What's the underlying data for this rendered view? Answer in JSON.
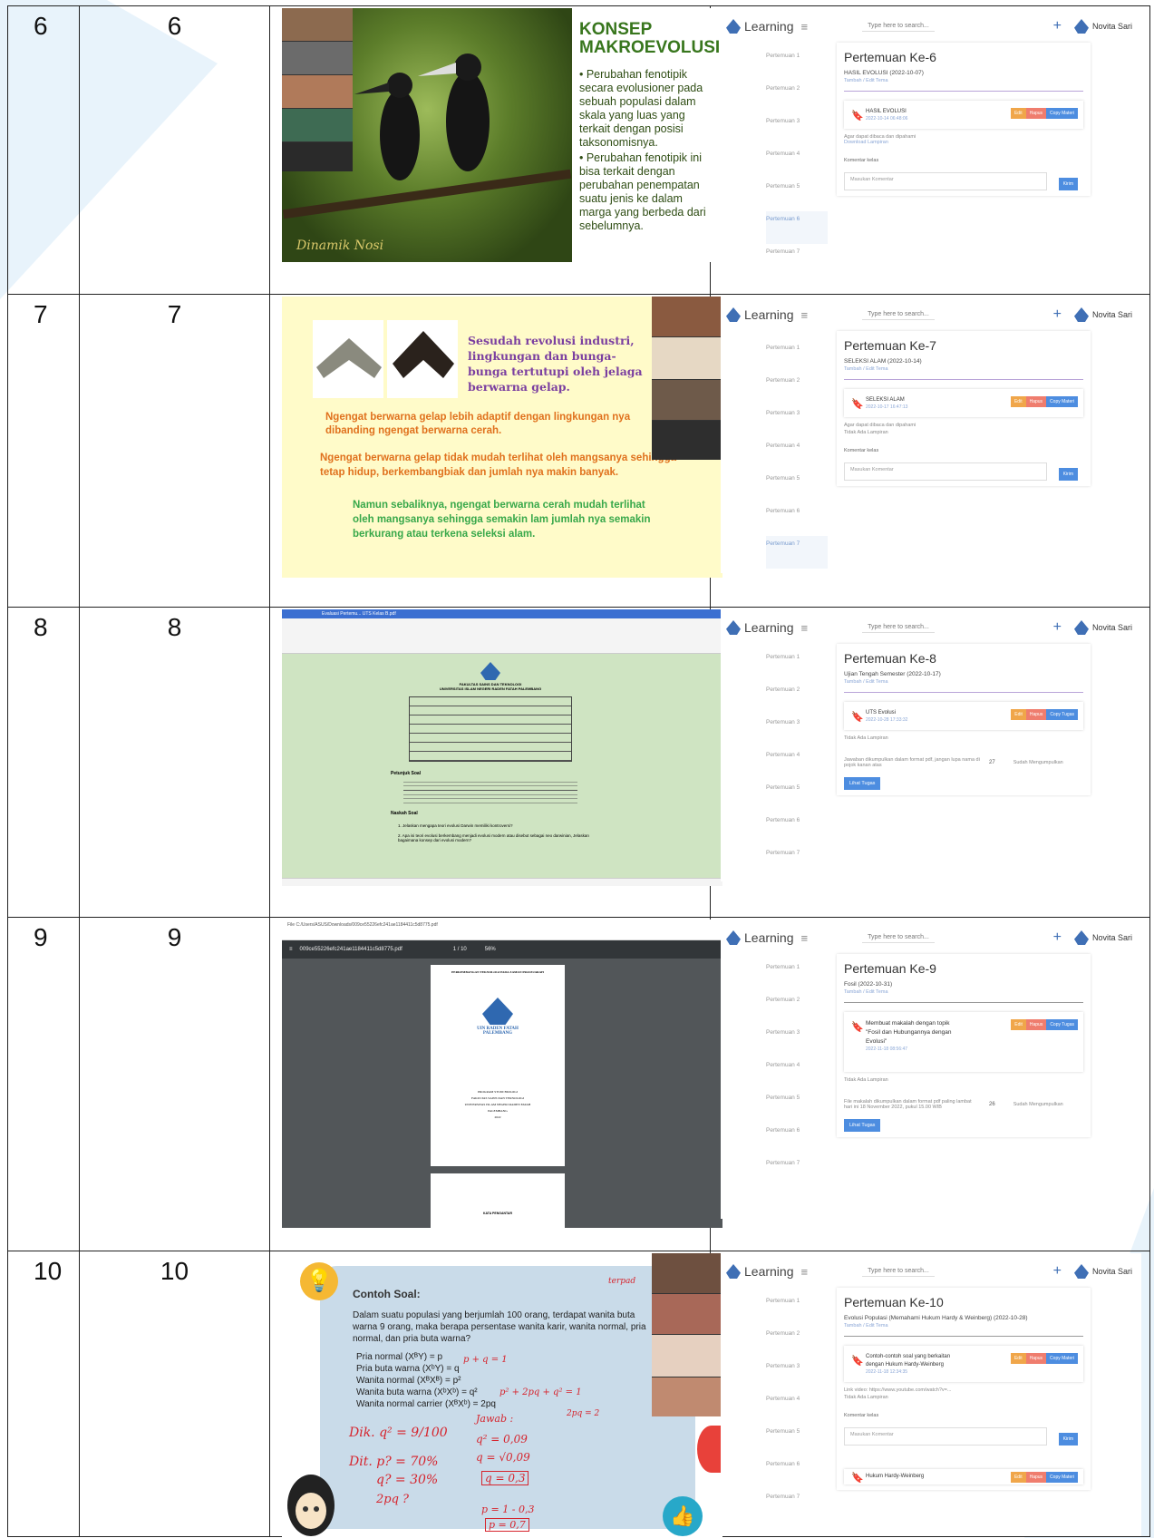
{
  "rows": [
    {
      "no_a": "6",
      "no_b": "6",
      "slide": {
        "title": "KONSEP MAKROEVOLUSI",
        "bullets": [
          "• Perubahan fenotipik secara evolusioner pada sebuah populasi dalam skala yang luas yang terkait dengan posisi taksonomisnya.",
          "• Perubahan fenotipik ini bisa terkait dengan perubahan penempatan suatu jenis ke dalam marga yang berbeda dari sebelumnya."
        ],
        "signature": "Dinamik Nosi"
      },
      "lms": {
        "title": "Pertemuan Ke-6",
        "subtitle": "HASIL EVOLUSI (2022-10-07)",
        "edit_link": "Tambah / Edit Tema",
        "item_title": "HASIL EVOLUSI",
        "item_date": "2022-10-14 06:48:06",
        "note1": "Agar dapat dibaca dan dipahami",
        "note2": "Download Lampiran",
        "komentar_label": "Komentar kelas",
        "komentar_placeholder": "Masukan Komentar",
        "active_index": 5
      }
    },
    {
      "no_a": "7",
      "no_b": "7",
      "slide": {
        "line1": "Sesudah revolusi industri, lingkungan dan bunga- bunga tertutupi oleh jelaga berwarna gelap.",
        "line2": "Ngengat berwarna gelap lebih adaptif dengan lingkungan nya dibanding ngengat berwarna cerah.",
        "line3": "Ngengat berwarna gelap tidak mudah terlihat oleh mangsanya sehingga tetap hidup, berkembangbiak dan jumlah nya makin banyak.",
        "line4": "Namun sebaliknya, ngengat berwarna cerah mudah terlihat oleh mangsanya sehingga semakin lam jumlah nya semakin berkurang atau terkena seleksi alam."
      },
      "lms": {
        "title": "Pertemuan Ke-7",
        "subtitle": "SELEKSI ALAM (2022-10-14)",
        "edit_link": "Tambah / Edit Tema",
        "item_title": "SELEKSI ALAM",
        "item_date": "2022-10-17 16:47:13",
        "note1": "Agar dapat dibaca dan dipahami",
        "note2": "Tidak Ada Lampiran",
        "komentar_label": "Komentar kelas",
        "komentar_placeholder": "Masukan Komentar",
        "active_index": 6
      }
    },
    {
      "no_a": "8",
      "no_b": "8",
      "slide": {
        "app_tab": "Evaluasi Pertemu... UTS Kelas B.pdf",
        "header1": "FAKULTAS SAINS DAN TEKNOLOGI",
        "header2": "UNIVERSITAS ISLAM NEGERI RADEN FATAH PALEMBANG",
        "section1": "Petunjuk Soal",
        "section2": "Naskah Soal",
        "q1": "1. Jelaskan mengapa teori evolusi Darwin memiliki kontroversi?",
        "q2": "2. Apa isi teori evolusi berkembang menjadi evolusi modern atau disebut sebagai neo darwinian, Jelaskan bagaimana konsep dari evolusi modern?"
      },
      "lms": {
        "title": "Pertemuan Ke-8",
        "subtitle": "Ujian Tengah Semester (2022-10-17)",
        "edit_link": "Tambah / Edit Tema",
        "item_title": "UTS Evolusi",
        "item_date": "2022-10-28 17:33:32",
        "note1": "Tidak Ada Lampiran",
        "note2": "Jawaban dikumpulkan dalam format pdf, jangan lupa nama di pojok kanan atas",
        "count": "27",
        "collected": "Sudah Mengumpulkan",
        "button": "Lihat Tugas",
        "active_index": -1
      }
    },
    {
      "no_a": "9",
      "no_b": "9",
      "slide": {
        "url": "File  C:/Users/ASUS/Downloads/009ce55226efc241ae1184411c5d8775.pdf",
        "filename": "009ce55226efc241ae1184411c5d8775.pdf",
        "page": "1 / 10",
        "zoom": "56%",
        "doc_title": "PERKEMBANGAN TEKNOLOGI PADA ZAMAN PRASEJARAH",
        "uin": "UIN RADEN FATAH PALEMBANG",
        "prodi": "PROGRAM STUDI BIOLOGI",
        "fak": "FAKULTAS SAINS DAN TEKNOLOGI",
        "univ": "UNIVERSITAS ISLAM NEGERI RADEN FATAH",
        "city": "PALEMBANG",
        "year": "2022",
        "next": "KATA PENGANTAR"
      },
      "lms": {
        "title": "Pertemuan Ke-9",
        "subtitle": "Fosil (2022-10-31)",
        "edit_link": "Tambah / Edit Tema",
        "item_title": "Membuat makalah dengan topik \"Fosil dan Hubungannya dengan Evolusi\"",
        "item_date": "2022-11-18 08:56:47",
        "note1": "Tidak Ada Lampiran",
        "note2": "File makalah dikumpulkan dalam format pdf paling lambat hari ini 18 November 2022, pukul 15.00 WIB",
        "count": "26",
        "collected": "Sudah Mengumpulkan",
        "button": "Lihat Tugas",
        "active_index": -1
      }
    },
    {
      "no_a": "10",
      "no_b": "10",
      "slide": {
        "title": "Contoh Soal:",
        "text": "Dalam suatu populasi yang berjumlah 100 orang, terdapat wanita buta warna 9 orang, maka berapa persentase wanita karir, wanita normal, pria normal, dan pria buta warna?",
        "f1": "Pria normal (XᴮY) = p",
        "f2": "Pria buta warna (XᵇY) = q",
        "f3": "Wanita normal (XᴮXᴮ) = p²",
        "f4": "Wanita buta warna (XᵇXᵇ) = q²",
        "f5": "Wanita normal carrier (XᴮXᵇ) = 2pq",
        "hw1": "Dik. q² = 9/100",
        "hw2": "Dit. p? = 70%",
        "hw3": "q? = 30%",
        "hw4": "2pq ?",
        "hw5": "q² = 0,09",
        "hw6": "q = √0,09",
        "hw7": "q = 0,3",
        "hw8": "p = 1 - 0,3",
        "hw9": "p = 0,7",
        "hw10": "p + q = 1",
        "hw11": "p² + 2pq + q² = 1",
        "hw12": "Jawab :",
        "hw13": "terpad",
        "hw14": "2pq = 2"
      },
      "lms": {
        "title": "Pertemuan Ke-10",
        "subtitle": "Evolusi Populasi (Memahami Hukum Hardy & Weinberg) (2022-10-28)",
        "edit_link": "Tambah / Edit Tema",
        "item_title": "Contoh-contoh soal yang berkaitan dengan Hukum Hardy-Weinberg",
        "item_date": "2022-11-18 12:34:35",
        "note1": "Link video: https://www.youtube.com/watch?v=...",
        "note2": "Tidak Ada Lampiran",
        "komentar_label": "Komentar kelas",
        "komentar_placeholder": "Masukan Komentar",
        "item2": "Hukum Hardy-Weinberg",
        "active_index": -1
      }
    }
  ],
  "lms_common": {
    "brand": "Learning",
    "search_placeholder": "Type here to search...",
    "user": "Novita Sari",
    "edit": "Edit",
    "hapus": "Hapus",
    "copy": "Copy Materi",
    "copy_tugas": "Copy Tugas",
    "kirim": "Kirim",
    "sidebar": [
      "Pertemuan 1",
      "Pertemuan 2",
      "Pertemuan 3",
      "Pertemuan 4",
      "Pertemuan 5",
      "Pertemuan 6",
      "Pertemuan 7"
    ]
  },
  "colors": {
    "slide6_green": "#3d5a1f",
    "slide7_yellow": "#fffbc9",
    "slide8_green": "#cfe4c2",
    "slide10_blue": "#c9dbe9",
    "accent": "#4d8de0"
  }
}
